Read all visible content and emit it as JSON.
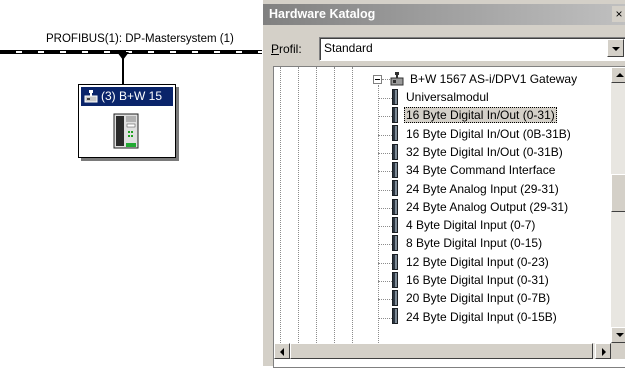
{
  "network": {
    "bus_label": "PROFIBUS(1): DP-Mastersystem (1)",
    "station_label": "(3) B+W 15",
    "station_icon": "network-node-icon",
    "device_icon": "gateway-device-icon"
  },
  "catalog": {
    "title": "Hardware Katalog",
    "close_label": "×",
    "profil_label_underlined": "P",
    "profil_label_rest": "rofil:",
    "profil_value": "Standard",
    "tree": {
      "parent_label": "B+W 1567 AS-i/DPV1 Gateway",
      "parent_icon": "device-folder-icon",
      "selected_index": 1,
      "items": [
        "Universalmodul",
        "16 Byte Digital In/Out (0-31)",
        "16 Byte Digital In/Out (0B-31B)",
        "32 Byte Digital In/Out (0-31B)",
        "34 Byte Command Interface",
        "24 Byte Analog Input (29-31)",
        "24 Byte Analog Output (29-31)",
        "4 Byte Digital Input (0-7)",
        "8 Byte Digital Input (0-15)",
        "12 Byte Digital Input (0-23)",
        "16 Byte Digital Input (0-31)",
        "20 Byte Digital Input (0-7B)",
        "24 Byte Digital Input (0-15B)"
      ]
    }
  },
  "colors": {
    "station_title_bg": "#0a246a",
    "window_bg": "#d4d0c8",
    "selection_bg": "#d4d0c8"
  }
}
